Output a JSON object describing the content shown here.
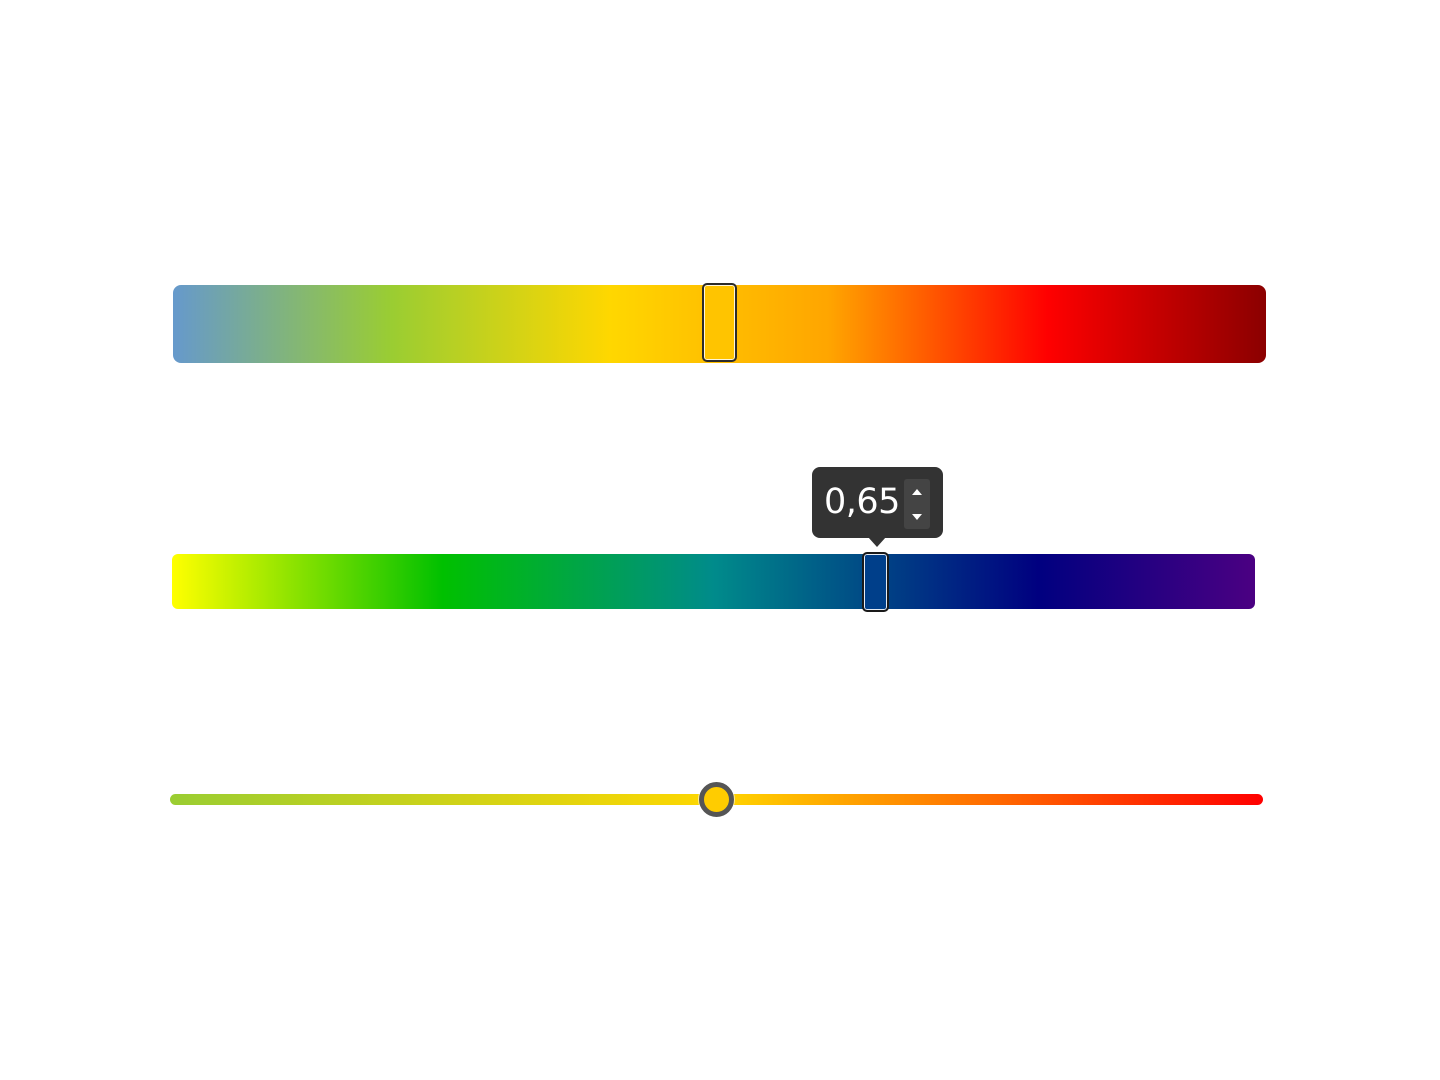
{
  "slider_top": {
    "value_fraction": 0.5,
    "thumb_color": "#ffc400",
    "gradient_stops": [
      {
        "color": "#6699cc",
        "at": 0.0
      },
      {
        "color": "#9acd32",
        "at": 0.2
      },
      {
        "color": "#ffd700",
        "at": 0.4
      },
      {
        "color": "#ffa500",
        "at": 0.6
      },
      {
        "color": "#ff0000",
        "at": 0.8
      },
      {
        "color": "#8b0000",
        "at": 1.0
      }
    ]
  },
  "slider_middle": {
    "value_fraction": 0.65,
    "value_label": "0,65",
    "thumb_color": "#003f8a",
    "tooltip_color": "#333333",
    "gradient_stops": [
      {
        "color": "#ffff00",
        "at": 0.0
      },
      {
        "color": "#00c000",
        "at": 0.25
      },
      {
        "color": "#008b8b",
        "at": 0.5
      },
      {
        "color": "#000080",
        "at": 0.8
      },
      {
        "color": "#4b0082",
        "at": 1.0
      }
    ]
  },
  "slider_bottom": {
    "value_fraction": 0.5,
    "thumb_color": "#ffcc00",
    "thumb_border_color": "#555555",
    "gradient_stops": [
      {
        "color": "#9acd32",
        "at": 0.0
      },
      {
        "color": "#ffd700",
        "at": 0.5
      },
      {
        "color": "#ff0000",
        "at": 1.0
      }
    ]
  }
}
